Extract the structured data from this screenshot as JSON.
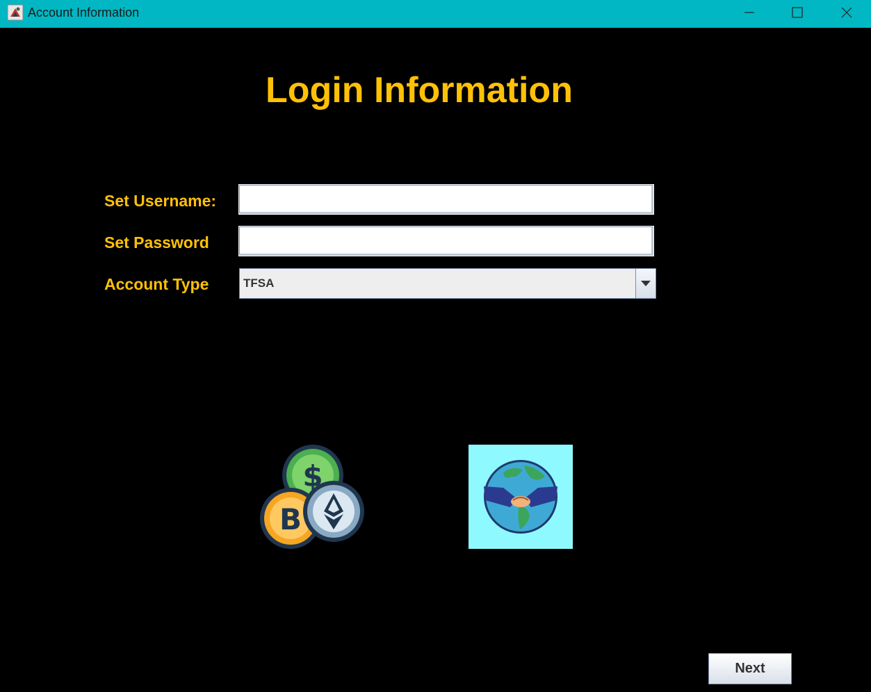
{
  "window": {
    "title": "Account Information",
    "titlebar_color": "#00b7c3"
  },
  "heading": "Login Information",
  "form": {
    "username_label": "Set Username:",
    "username_value": "",
    "password_label": "Set Password",
    "password_value": "",
    "account_type_label": "Account Type",
    "account_type_value": "TFSA"
  },
  "images": {
    "left": "crypto-coins-icon",
    "right": "globe-handshake-icon"
  },
  "next_label": "Next",
  "colors": {
    "accent": "#ffc107",
    "background": "#000000",
    "globe_background": "#8ef9ff"
  }
}
